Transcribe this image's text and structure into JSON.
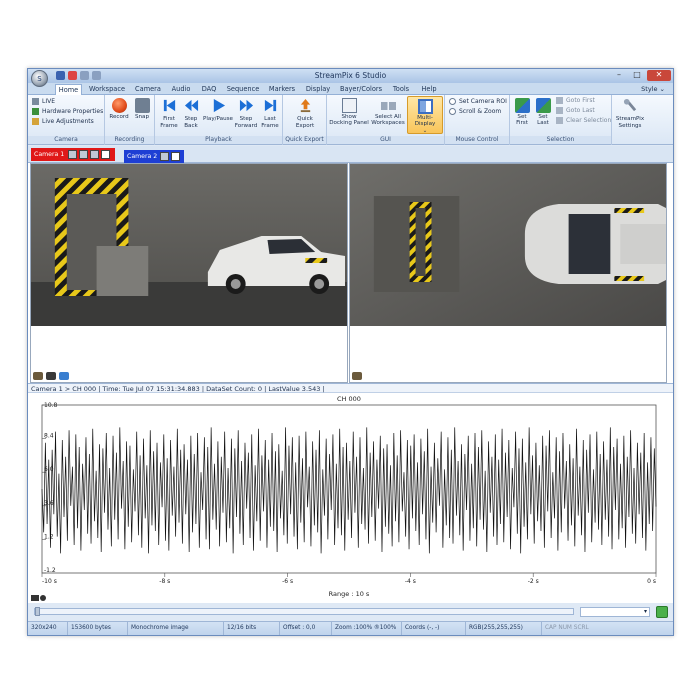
{
  "window": {
    "title": "StreamPix 6 Studio",
    "minimize_glyph": "–",
    "maximize_glyph": "□",
    "close_glyph": "✕",
    "orb_icon": "streampix-orb-icon",
    "orb_glyph": "S"
  },
  "tabs": [
    "Home",
    "Workspace",
    "Camera",
    "Audio",
    "DAQ",
    "Sequence",
    "Markers",
    "Display",
    "Bayer/Colors",
    "Tools",
    "Help"
  ],
  "style_menu": "Style ⌄",
  "ribbon": {
    "camera_group": {
      "label": "Camera",
      "items": [
        "LIVE",
        "Hardware Properties",
        "Live Adjustments"
      ]
    },
    "recording_group": {
      "label": "Recording",
      "buttons": [
        "Record",
        "Snap"
      ]
    },
    "playback_group": {
      "label": "Playback",
      "buttons": [
        {
          "l1": "First",
          "l2": "Frame"
        },
        {
          "l1": "Step",
          "l2": "Back"
        },
        {
          "l1": "Play/Pause",
          "l2": ""
        },
        {
          "l1": "Step",
          "l2": "Forward"
        },
        {
          "l1": "Last",
          "l2": "Frame"
        }
      ]
    },
    "export_group": {
      "label": "Quick Export",
      "button": {
        "l1": "Quick",
        "l2": "Export"
      }
    },
    "gui_group": {
      "label": "GUI",
      "buttons": [
        {
          "l1": "Show",
          "l2": "Docking Panel"
        },
        {
          "l1": "Select All",
          "l2": "Workspaces"
        },
        {
          "l1": "Multi-Display",
          "l2": "⌄"
        }
      ]
    },
    "mouse_group": {
      "label": "Mouse Control",
      "items": [
        "Set Camera ROI",
        "Scroll & Zoom"
      ]
    },
    "selection_group": {
      "label": "Selection",
      "buttons": [
        {
          "l1": "Set",
          "l2": "First"
        },
        {
          "l1": "Set",
          "l2": "Last"
        }
      ],
      "items": [
        "Goto First",
        "Goto Last",
        "Clear Selection"
      ]
    },
    "settings_button": {
      "l1": "StreamPix",
      "l2": "Settings"
    }
  },
  "camera_tabs": [
    "Camera 1",
    "Camera 2"
  ],
  "chart_header": "Camera 1 > CH 000 | Time: Tue Jul 07 15:31:34.883 | DataSet Count: 0 | LastValue 3.543 |",
  "chart_data": {
    "type": "line",
    "title": "CH 000",
    "xlabel": "Range : 10 s",
    "ylabel": "",
    "x_ticks": [
      "-10 s",
      "-8 s",
      "-6 s",
      "-4 s",
      "-2 s",
      "0 s"
    ],
    "y_ticks": [
      "10.8",
      "8.4",
      "6.0",
      "3.6",
      "1.2",
      "-1.2"
    ],
    "xlim": [
      -10,
      0
    ],
    "ylim": [
      -1.2,
      10.8
    ],
    "grid": false,
    "series": [
      {
        "values": [
          4.8,
          1.7,
          8.1,
          2.3,
          6.9,
          0.6,
          7.6,
          3.0,
          8.9,
          1.4,
          5.9,
          0.2,
          8.3,
          2.8,
          7.1,
          1.1,
          9.0,
          3.6,
          6.4,
          0.8,
          8.7,
          2.0,
          7.8,
          0.4,
          6.6,
          3.3,
          8.5,
          1.6,
          7.3,
          0.9,
          9.1,
          2.5,
          6.1,
          1.3,
          8.0,
          0.3,
          7.7,
          3.1,
          8.8,
          1.9,
          6.3,
          0.7,
          8.6,
          2.6,
          7.4,
          1.2,
          9.2,
          3.4,
          6.8,
          0.5,
          8.2,
          2.1,
          7.9,
          1.0,
          6.2,
          3.2,
          8.9,
          1.5,
          7.2,
          0.6,
          8.4,
          2.7,
          6.5,
          0.2,
          9.0,
          2.2,
          7.5,
          1.8,
          8.1,
          0.8,
          6.7,
          3.5,
          8.7,
          1.1,
          7.0,
          0.4,
          8.3,
          2.9,
          6.4,
          1.4,
          9.1,
          2.4,
          7.6,
          0.9,
          8.0,
          3.0,
          6.9,
          0.3,
          8.6,
          1.7,
          7.3,
          2.3,
          8.8,
          0.6,
          6.0,
          3.3,
          8.5,
          1.2,
          7.8,
          0.5,
          9.2,
          2.6,
          6.6,
          1.9,
          8.2,
          0.7,
          7.1,
          3.1,
          8.9,
          1.0,
          6.3,
          2.0,
          8.4,
          0.2,
          7.7,
          2.8,
          9.0,
          1.6,
          6.8,
          0.8,
          8.1,
          3.4,
          7.4,
          1.3,
          8.7,
          0.4,
          6.5,
          2.5,
          9.1,
          1.1,
          7.2,
          3.2,
          8.3,
          0.6,
          6.9,
          2.1,
          8.8,
          1.8,
          7.5,
          0.3,
          8.0,
          2.7,
          6.1,
          1.5,
          9.2,
          0.9,
          7.9,
          3.0,
          8.5,
          1.4,
          6.7,
          0.5,
          8.6,
          2.4,
          7.0,
          1.0,
          8.9,
          3.5,
          6.4,
          0.7,
          8.2,
          2.2,
          7.6,
          1.7,
          9.0,
          0.2,
          6.2,
          2.9,
          8.4,
          1.2,
          7.3,
          3.3,
          8.7,
          0.8,
          6.6,
          2.0,
          9.1,
          1.5,
          7.8,
          0.4,
          8.1,
          2.6,
          6.8,
          1.3,
          8.9,
          3.1,
          7.1,
          0.6,
          8.5,
          2.3,
          6.3,
          1.9,
          9.2,
          0.9,
          7.4,
          2.8,
          8.2,
          1.1,
          6.9,
          3.4,
          8.6,
          0.3,
          7.7,
          2.1,
          8.0,
          1.6,
          6.5,
          0.7,
          8.8,
          2.5,
          7.2,
          1.0,
          9.0,
          3.2,
          6.0,
          1.4,
          8.3,
          0.5,
          7.9,
          2.7,
          8.7,
          1.8,
          6.7,
          0.8,
          8.4,
          3.0,
          7.5,
          1.2,
          9.1,
          0.2,
          6.4,
          2.4,
          8.1,
          1.7,
          7.0,
          3.6,
          8.9,
          0.6,
          6.2,
          2.2,
          8.5,
          1.3,
          7.6,
          0.9,
          9.2,
          2.9,
          6.8,
          1.5,
          8.0,
          0.4,
          7.3,
          3.3,
          8.6,
          1.1,
          6.6,
          2.0,
          8.8,
          0.7,
          7.8,
          2.6,
          9.0,
          1.9,
          6.1,
          0.3,
          8.2,
          3.1,
          7.1,
          1.4,
          8.7,
          0.8,
          6.9,
          2.3,
          9.1,
          1.0,
          7.4,
          2.8,
          8.3,
          0.5,
          6.3,
          3.5,
          8.9,
          1.6,
          7.7,
          0.2,
          8.4,
          2.1,
          6.7,
          1.2,
          9.2,
          3.0,
          7.2,
          0.9,
          8.1,
          2.5,
          6.5,
          1.8,
          8.6,
          0.6,
          7.9,
          3.2,
          9.0,
          1.3,
          6.0,
          2.7,
          8.5,
          0.4,
          7.5,
          1.7,
          8.8,
          3.4,
          6.8,
          1.1,
          8.0,
          2.2,
          7.0,
          0.7,
          9.1,
          2.9,
          6.4,
          1.5,
          8.3,
          0.3,
          7.6,
          3.1,
          8.7,
          1.0,
          6.2,
          2.4,
          8.9,
          1.9,
          7.3,
          0.8,
          8.2,
          2.6,
          6.9,
          1.4,
          9.2,
          0.5,
          7.8,
          3.3,
          8.4,
          1.2,
          6.6,
          2.0,
          8.6,
          0.6,
          7.1,
          2.8,
          9.0,
          1.6,
          6.3,
          0.9,
          8.1,
          3.0,
          7.4,
          1.3,
          8.8,
          0.4,
          6.7,
          2.3,
          8.5,
          1.8,
          7.7,
          3.543
        ]
      }
    ]
  },
  "statusbar": {
    "resolution": "320x240",
    "bytes": "153600 bytes",
    "image_type": "Monochrome image",
    "bits": "12/16 bits",
    "offset": "Offset : 0,0",
    "zoom": "Zoom :100% ®100%",
    "coords": "Coords (-, -)",
    "rgb": "RGB(255,255,255)",
    "indicators": "CAP  NUM  SCRL"
  },
  "colors": {
    "accent": "#3b6ec2",
    "camera1_tab": "#e01818",
    "camera2_tab": "#1e3fd4",
    "record": "#e04a1a",
    "playback": "#1c6fd6"
  }
}
